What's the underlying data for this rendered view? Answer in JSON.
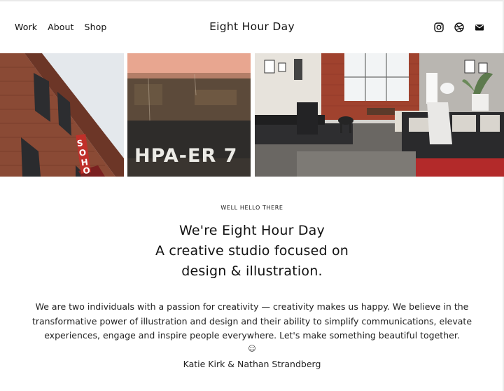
{
  "nav": {
    "links": [
      "Work",
      "About",
      "Shop"
    ],
    "brand": "Eight Hour Day",
    "social_icons": [
      "instagram-icon",
      "dribbble-icon",
      "mail-icon"
    ]
  },
  "gallery": {
    "images": [
      "soho-brick-building-photo",
      "weathered-sign-photo",
      "loft-studio-photo"
    ],
    "sign_text": "HPA-ER  7",
    "building_sign_text": "SOHO"
  },
  "intro": {
    "eyebrow": "WELL HELLO THERE",
    "headline_lines": [
      "We're Eight Hour Day",
      "A creative studio focused on",
      "design & illustration."
    ],
    "body_lines": [
      "We are two individuals with a passion for creativity — creativity makes us happy. We believe in the",
      "transformative power of illustration and design and their ability to simplify communications, elevate",
      "experiences, engage and inspire people everywhere. Let's make something beautiful together."
    ],
    "smiley": "☺",
    "signature": "Katie Kirk & Nathan Strandberg"
  },
  "colors": {
    "text": "#111111",
    "background": "#ffffff"
  }
}
